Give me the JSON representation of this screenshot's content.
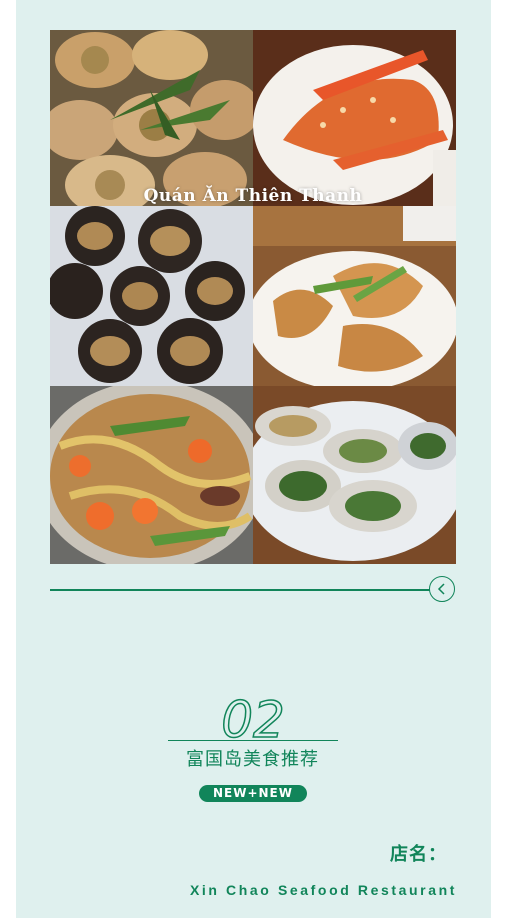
{
  "collage": {
    "overlay_text": "Quán Ăn Thiên Thanh",
    "photos": [
      {
        "subject": "grilled scallops with peanuts"
      },
      {
        "subject": "lobster with garlic"
      },
      {
        "subject": "sea urchins"
      },
      {
        "subject": "fried lobster with scallions"
      },
      {
        "subject": "noodle hot pot"
      },
      {
        "subject": "grilled oysters with scallion oil"
      }
    ]
  },
  "section": {
    "number": "02",
    "title": "富国岛美食推荐",
    "badge": "NEW+NEW"
  },
  "shop": {
    "label": "店名：",
    "name": "Xin Chao Seafood Restaurant"
  },
  "colors": {
    "accent": "#11855a",
    "background": "#dff0ee"
  },
  "icons": {
    "arrow": "chevron-left-icon"
  }
}
